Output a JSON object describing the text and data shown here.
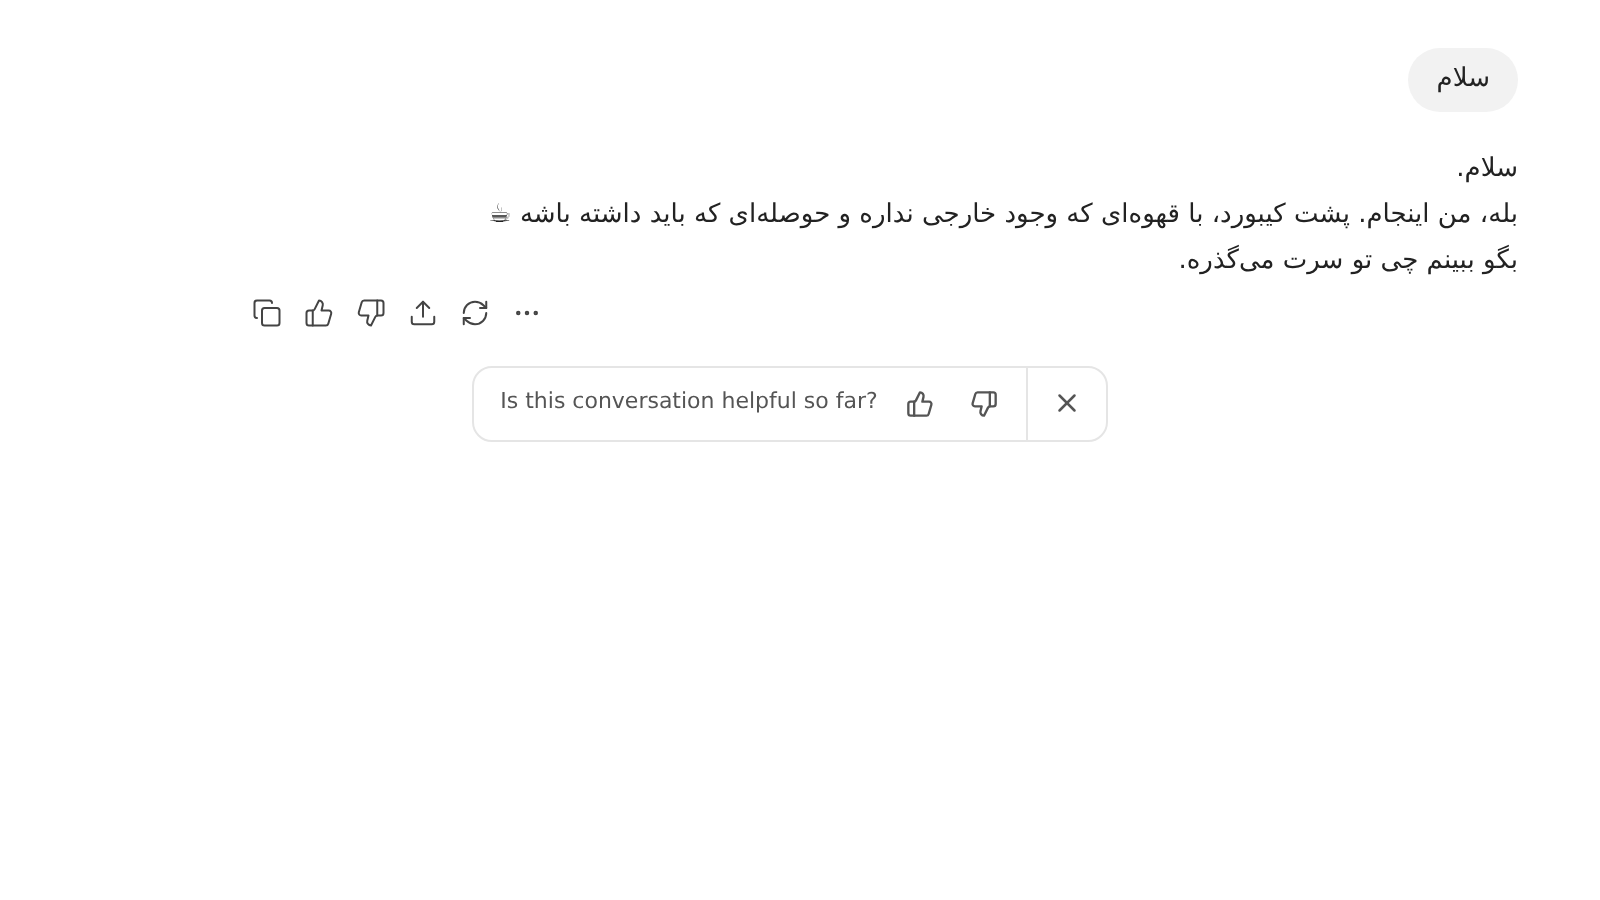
{
  "user_message": {
    "text": "سلام"
  },
  "assistant_message": {
    "lines": [
      "سلام.",
      "بله، من اینجام. پشت کیبورد، با قهوه‌ای که وجود خارجی نداره و حوصله‌ای که باید داشته باشه ☕",
      "بگو ببینم چی تو سرت می‌گذره."
    ]
  },
  "feedback": {
    "question": "Is this conversation helpful so far?"
  }
}
